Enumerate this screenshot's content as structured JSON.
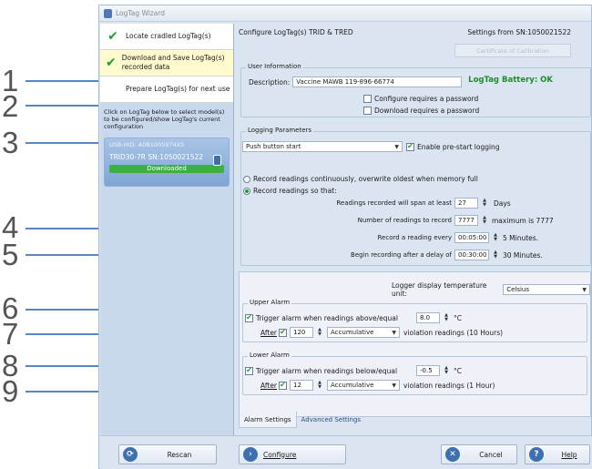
{
  "callouts": [
    "1",
    "2",
    "3",
    "4",
    "5",
    "6",
    "7",
    "8",
    "9"
  ],
  "window": {
    "title": "LogTag Wizard"
  },
  "steps": [
    {
      "label": "Locate cradled LogTag(s)",
      "checked": true
    },
    {
      "label": "Download and Save LogTag(s) recorded data",
      "checked": true
    },
    {
      "label": "Prepare LogTag(s) for next use",
      "checked": false
    }
  ],
  "instructions": "Click on LogTag below to select model(s) to be configured/show LogTag's current configuration",
  "device": {
    "hid": "USB-HID: A0B1005974X5",
    "model": "TRID30-7R SN:1050021522",
    "status": "Downloaded"
  },
  "header": {
    "title": "Configure LogTag(s) TRID & TRED",
    "settings_from": "Settings from  SN:1050021522",
    "certificate_button": "Certificate of Calibration"
  },
  "user_info": {
    "group_title": "User Information",
    "description_label": "Description:",
    "description_value": "Vaccine MAWB 119-896-66774",
    "battery_status": "LogTag Battery: OK",
    "configure_password": "Configure requires a password",
    "download_password": "Download requires a password"
  },
  "logging": {
    "group_title": "Logging Parameters",
    "start_mode": "Push button start",
    "enable_prestart": "Enable pre-start logging",
    "record_continuous": "Record readings continuously, overwrite oldest when memory full",
    "record_so_that": "Record readings so that:",
    "span_label": "Readings recorded will span at least",
    "span_value": "27",
    "span_unit": "Days",
    "number_label": "Number of readings to record",
    "number_value": "7777",
    "number_max": "maximum is 7777",
    "every_label": "Record a reading every",
    "every_value": "00:05:00",
    "every_note": "5 Minutes.",
    "delay_label": "Begin recording after a delay of",
    "delay_value": "00:30:00",
    "delay_note": "30 Minutes."
  },
  "alarms": {
    "display_unit_label": "Logger display temperature unit:",
    "display_unit_value": "Celsius",
    "upper": {
      "group_title": "Upper Alarm",
      "trigger_label": "Trigger alarm when readings above/equal",
      "threshold": "8.0",
      "unit": "°C",
      "after_label": "After",
      "after_value": "120",
      "mode": "Accumulative",
      "violation": "violation readings (10 Hours)"
    },
    "lower": {
      "group_title": "Lower Alarm",
      "trigger_label": "Trigger alarm when readings below/equal",
      "threshold": "-0.5",
      "unit": "°C",
      "after_label": "After",
      "after_value": "12",
      "mode": "Accumulative",
      "violation": "violation readings (1 Hour)"
    }
  },
  "tabs": [
    "Alarm Settings",
    "Advanced Settings"
  ],
  "buttons": {
    "rescan": "Rescan",
    "configure": "Configure",
    "cancel": "Cancel",
    "help": "Help"
  },
  "colors": {
    "accent": "#5b86c4",
    "ok_green": "#1f8c2a",
    "panel": "#dbe5f1"
  }
}
